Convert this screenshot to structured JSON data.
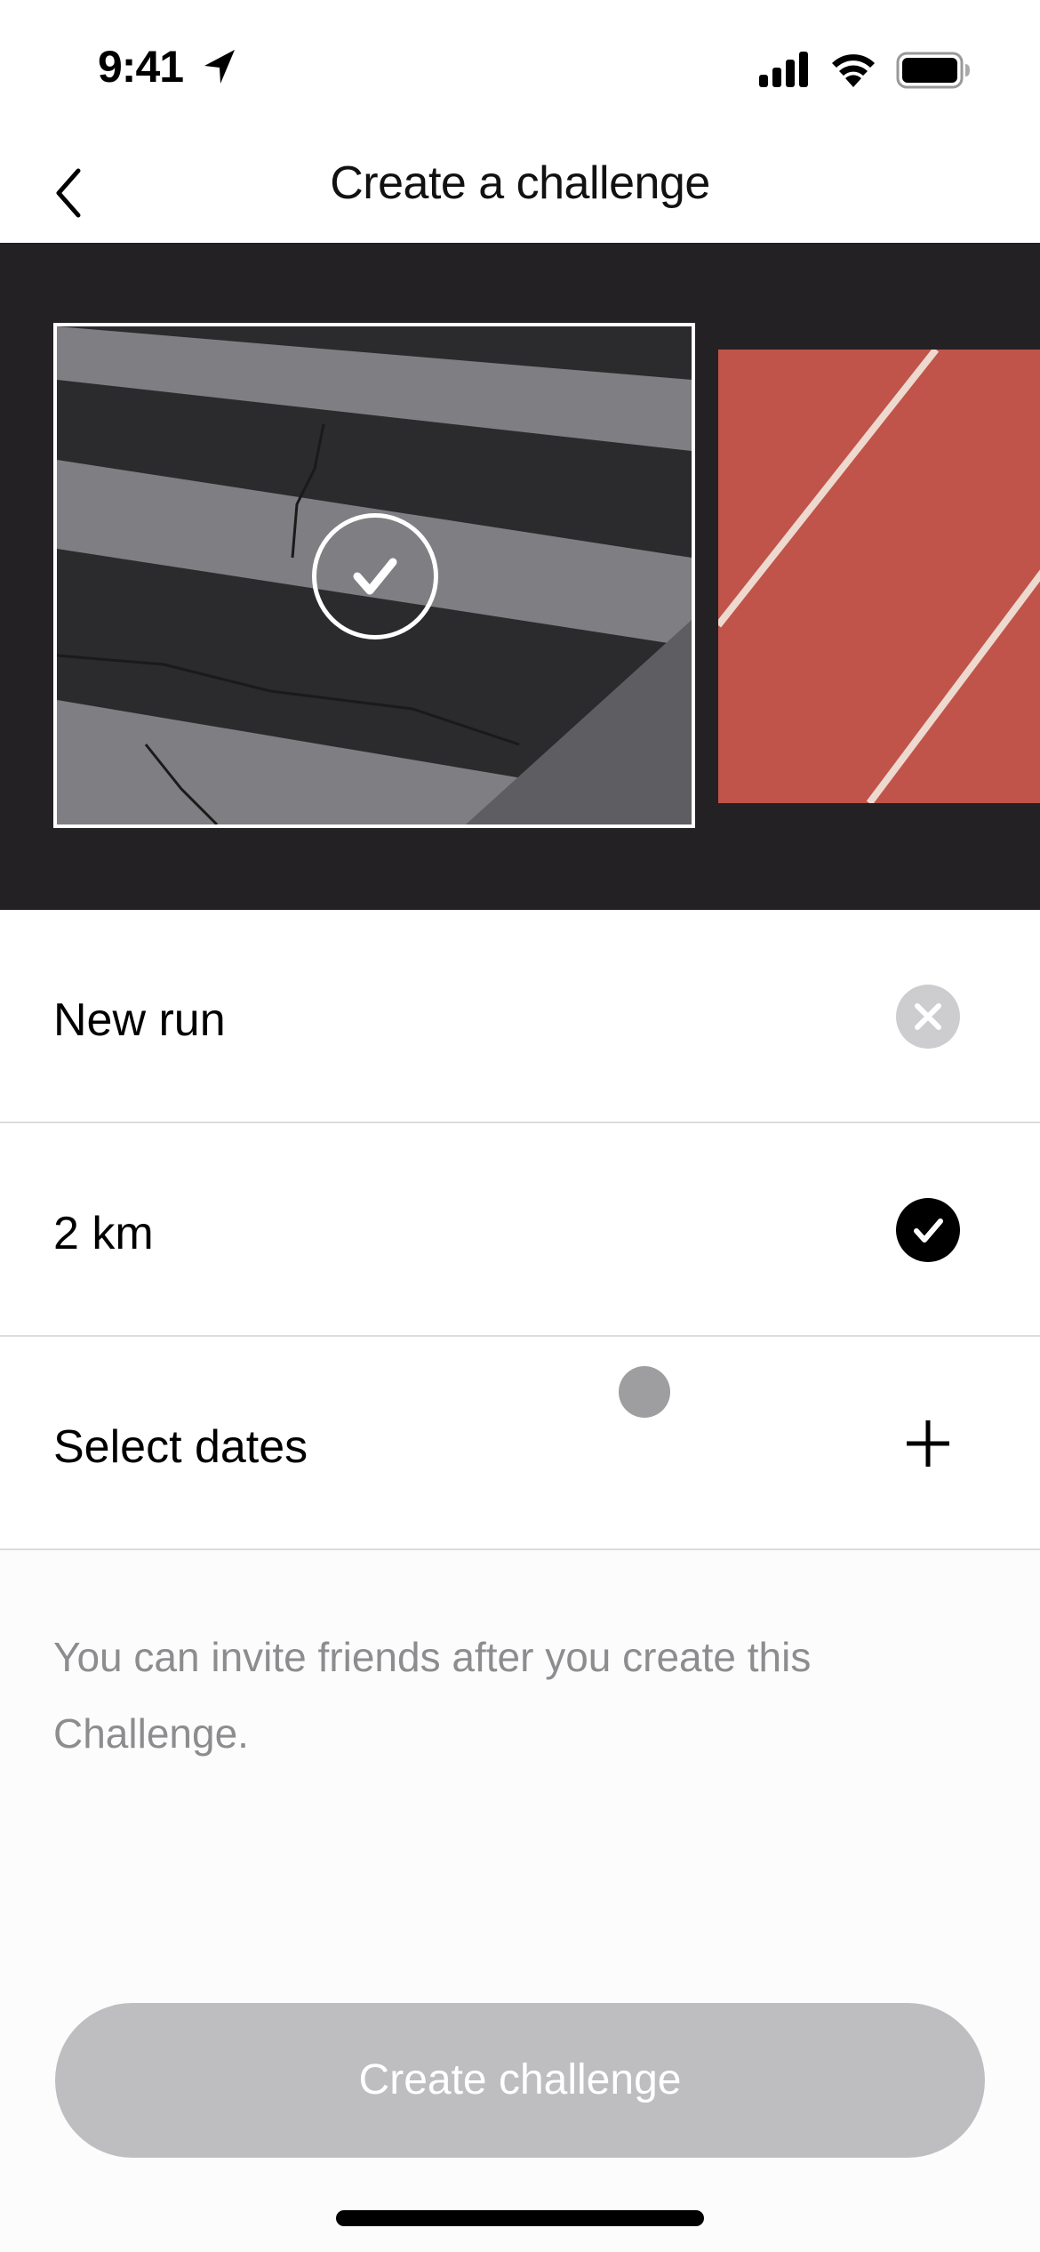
{
  "status_bar": {
    "time": "9:41",
    "icons": [
      "location-arrow-icon",
      "cellular-signal-icon",
      "wifi-icon",
      "battery-icon"
    ]
  },
  "nav": {
    "title": "Create a challenge",
    "back_icon": "chevron-left-icon"
  },
  "carousel": {
    "images": [
      {
        "name": "asphalt-crosswalk",
        "selected": true
      },
      {
        "name": "running-track",
        "selected": false
      }
    ],
    "selected_icon": "checkmark-circle-icon"
  },
  "form": {
    "rows": [
      {
        "label": "New run",
        "action_icon": "clear-icon"
      },
      {
        "label": "2 km",
        "action_icon": "checkmark-filled-icon"
      },
      {
        "label": "Select dates",
        "action_icon": "plus-icon"
      }
    ]
  },
  "hint": "You can invite friends after you create this Challenge.",
  "create_button": {
    "label": "Create challenge",
    "enabled": false
  },
  "colors": {
    "carousel_bg": "#232124",
    "button_disabled": "#bebdc0",
    "hint_text": "#8d8c8f",
    "track_red": "#c0544a"
  }
}
